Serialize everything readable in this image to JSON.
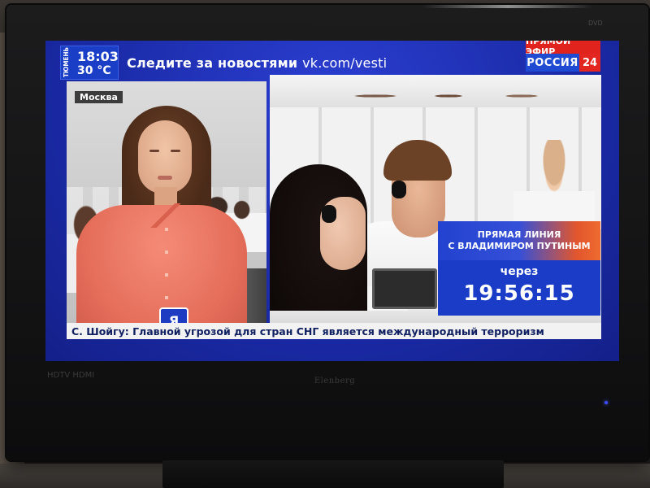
{
  "broadcast": {
    "city": "ТЮМЕНЬ",
    "time": "18:03",
    "temperature": "30 °C",
    "promo_text": "Следите за новостями",
    "promo_link": "vk.com/vesti",
    "live_label": "ПРЯМОЙ ЭФИР",
    "channel_name": "РОССИЯ",
    "channel_number": "24",
    "location": "Москва",
    "mic_label": "Я",
    "promo_card": {
      "line1": "ПРЯМАЯ ЛИНИЯ",
      "line2": "С ВЛАДИМИРОМ ПУТИНЫМ",
      "countdown_label": "через",
      "countdown": "19:56:15"
    },
    "ticker": "С. Шойгу: Главной угрозой для стран СНГ является международный терроризм"
  },
  "tv": {
    "brand": "Elenberg",
    "hd_label": "HDTV HDMI",
    "corner_label": "DVD"
  },
  "colors": {
    "screen_blue": "#1e2fb2",
    "live_red": "#e0241d",
    "channel_blue": "#1f4ad2",
    "promo_orange": "#ef6a2f"
  }
}
